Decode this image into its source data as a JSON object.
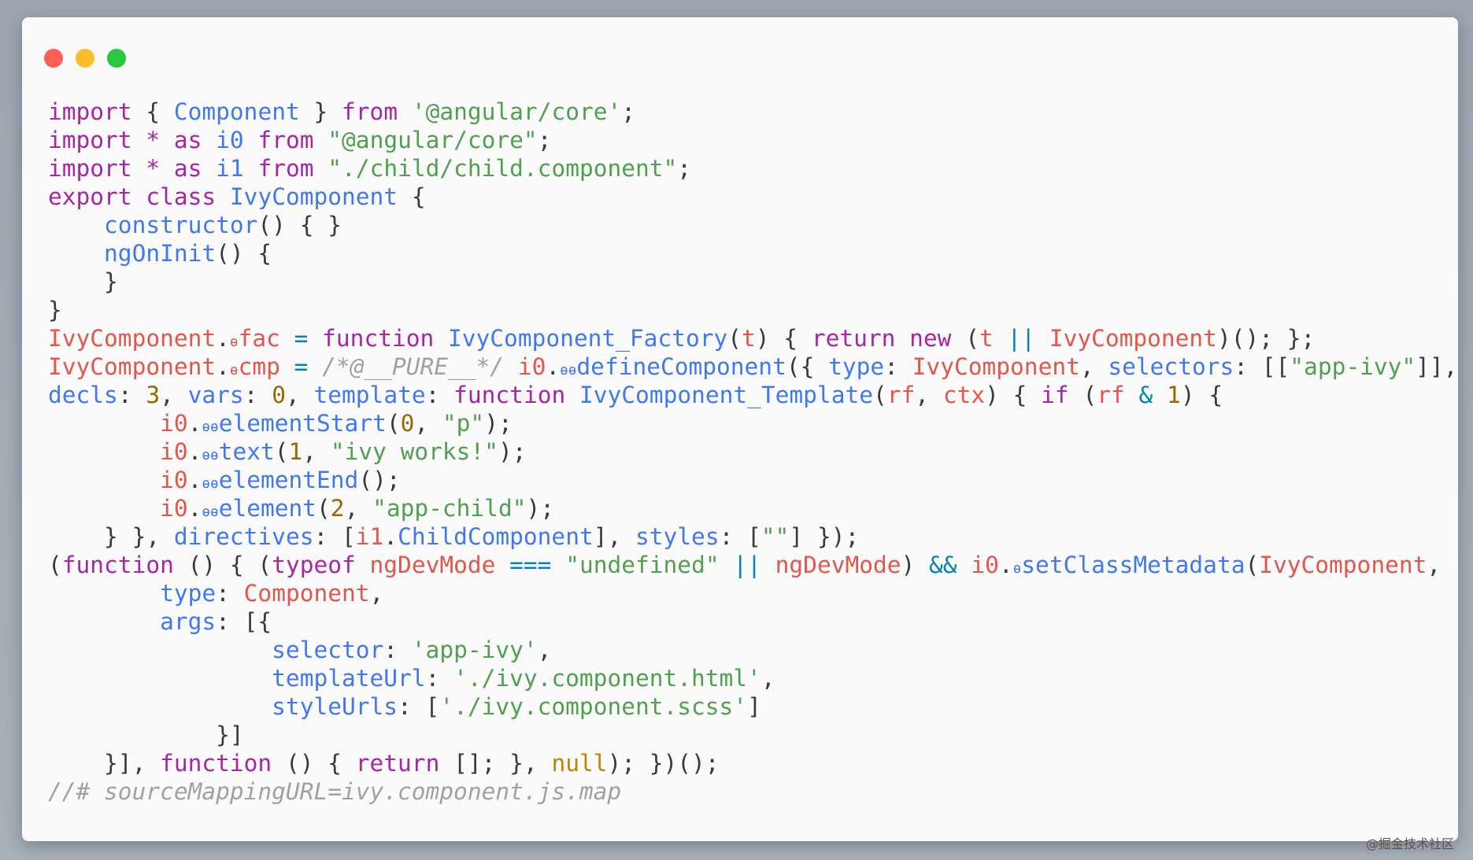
{
  "colors": {
    "keyword": "#a626a4",
    "name": "#4078f2",
    "string": "#50a14f",
    "variable": "#e45649",
    "number": "#986801",
    "constant": "#c18401",
    "operator": "#0184bc",
    "comment": "#a0a1a7",
    "plain": "#383a42"
  },
  "window": {
    "buttons": [
      "close",
      "minimize",
      "maximize"
    ]
  },
  "code_lines": [
    [
      [
        "k",
        "import"
      ],
      [
        "p",
        " { "
      ],
      [
        "n",
        "Component"
      ],
      [
        "p",
        " } "
      ],
      [
        "k",
        "from"
      ],
      [
        "p",
        " "
      ],
      [
        "s",
        "'@angular/core'"
      ],
      [
        "p",
        ";"
      ]
    ],
    [
      [
        "k",
        "import"
      ],
      [
        "p",
        " "
      ],
      [
        "k",
        "*"
      ],
      [
        "p",
        " "
      ],
      [
        "k",
        "as"
      ],
      [
        "p",
        " "
      ],
      [
        "n",
        "i0"
      ],
      [
        "p",
        " "
      ],
      [
        "k",
        "from"
      ],
      [
        "p",
        " "
      ],
      [
        "s",
        "\"@angular/core\""
      ],
      [
        "p",
        ";"
      ]
    ],
    [
      [
        "k",
        "import"
      ],
      [
        "p",
        " "
      ],
      [
        "k",
        "*"
      ],
      [
        "p",
        " "
      ],
      [
        "k",
        "as"
      ],
      [
        "p",
        " "
      ],
      [
        "n",
        "i1"
      ],
      [
        "p",
        " "
      ],
      [
        "k",
        "from"
      ],
      [
        "p",
        " "
      ],
      [
        "s",
        "\"./child/child.component\""
      ],
      [
        "p",
        ";"
      ]
    ],
    [
      [
        "k",
        "export"
      ],
      [
        "p",
        " "
      ],
      [
        "k",
        "class"
      ],
      [
        "p",
        " "
      ],
      [
        "n",
        "IvyComponent"
      ],
      [
        "p",
        " {"
      ]
    ],
    [
      [
        "p",
        "    "
      ],
      [
        "n",
        "constructor"
      ],
      [
        "p",
        "() { }"
      ]
    ],
    [
      [
        "p",
        "    "
      ],
      [
        "n",
        "ngOnInit"
      ],
      [
        "p",
        "() {"
      ]
    ],
    [
      [
        "p",
        "    }"
      ]
    ],
    [
      [
        "p",
        "}"
      ]
    ],
    [
      [
        "v",
        "IvyComponent"
      ],
      [
        "p",
        "."
      ],
      [
        "vsub",
        "ɵ"
      ],
      [
        "v",
        "fac"
      ],
      [
        "p",
        " "
      ],
      [
        "o",
        "="
      ],
      [
        "p",
        " "
      ],
      [
        "k",
        "function"
      ],
      [
        "p",
        " "
      ],
      [
        "n",
        "IvyComponent_Factory"
      ],
      [
        "p",
        "("
      ],
      [
        "v",
        "t"
      ],
      [
        "p",
        ") { "
      ],
      [
        "k",
        "return"
      ],
      [
        "p",
        " "
      ],
      [
        "k",
        "new"
      ],
      [
        "p",
        " ("
      ],
      [
        "v",
        "t"
      ],
      [
        "p",
        " "
      ],
      [
        "o",
        "||"
      ],
      [
        "p",
        " "
      ],
      [
        "v",
        "IvyComponent"
      ],
      [
        "p",
        ")(); };"
      ]
    ],
    [
      [
        "v",
        "IvyComponent"
      ],
      [
        "p",
        "."
      ],
      [
        "vsub",
        "ɵ"
      ],
      [
        "v",
        "cmp"
      ],
      [
        "p",
        " "
      ],
      [
        "o",
        "="
      ],
      [
        "p",
        " "
      ],
      [
        "c",
        "/*@__PURE__*/"
      ],
      [
        "p",
        " "
      ],
      [
        "v",
        "i0"
      ],
      [
        "p",
        "."
      ],
      [
        "nsub",
        "ɵɵ"
      ],
      [
        "n",
        "defineComponent"
      ],
      [
        "p",
        "({ "
      ],
      [
        "n",
        "type"
      ],
      [
        "p",
        ": "
      ],
      [
        "v",
        "IvyComponent"
      ],
      [
        "p",
        ", "
      ],
      [
        "n",
        "selectors"
      ],
      [
        "p",
        ": [["
      ],
      [
        "s",
        "\"app-ivy\""
      ],
      [
        "p",
        "]],"
      ]
    ],
    [
      [
        "n",
        "decls"
      ],
      [
        "p",
        ": "
      ],
      [
        "m",
        "3"
      ],
      [
        "p",
        ", "
      ],
      [
        "n",
        "vars"
      ],
      [
        "p",
        ": "
      ],
      [
        "m",
        "0"
      ],
      [
        "p",
        ", "
      ],
      [
        "n",
        "template"
      ],
      [
        "p",
        ": "
      ],
      [
        "k",
        "function"
      ],
      [
        "p",
        " "
      ],
      [
        "n",
        "IvyComponent_Template"
      ],
      [
        "p",
        "("
      ],
      [
        "v",
        "rf"
      ],
      [
        "p",
        ", "
      ],
      [
        "v",
        "ctx"
      ],
      [
        "p",
        ") { "
      ],
      [
        "k",
        "if"
      ],
      [
        "p",
        " ("
      ],
      [
        "v",
        "rf"
      ],
      [
        "p",
        " "
      ],
      [
        "o",
        "&"
      ],
      [
        "p",
        " "
      ],
      [
        "m",
        "1"
      ],
      [
        "p",
        ") {"
      ]
    ],
    [
      [
        "p",
        "        "
      ],
      [
        "v",
        "i0"
      ],
      [
        "p",
        "."
      ],
      [
        "nsub",
        "ɵɵ"
      ],
      [
        "n",
        "elementStart"
      ],
      [
        "p",
        "("
      ],
      [
        "m",
        "0"
      ],
      [
        "p",
        ", "
      ],
      [
        "s",
        "\"p\""
      ],
      [
        "p",
        ");"
      ]
    ],
    [
      [
        "p",
        "        "
      ],
      [
        "v",
        "i0"
      ],
      [
        "p",
        "."
      ],
      [
        "nsub",
        "ɵɵ"
      ],
      [
        "n",
        "text"
      ],
      [
        "p",
        "("
      ],
      [
        "m",
        "1"
      ],
      [
        "p",
        ", "
      ],
      [
        "s",
        "\"ivy works!\""
      ],
      [
        "p",
        ");"
      ]
    ],
    [
      [
        "p",
        "        "
      ],
      [
        "v",
        "i0"
      ],
      [
        "p",
        "."
      ],
      [
        "nsub",
        "ɵɵ"
      ],
      [
        "n",
        "elementEnd"
      ],
      [
        "p",
        "();"
      ]
    ],
    [
      [
        "p",
        "        "
      ],
      [
        "v",
        "i0"
      ],
      [
        "p",
        "."
      ],
      [
        "nsub",
        "ɵɵ"
      ],
      [
        "n",
        "element"
      ],
      [
        "p",
        "("
      ],
      [
        "m",
        "2"
      ],
      [
        "p",
        ", "
      ],
      [
        "s",
        "\"app-child\""
      ],
      [
        "p",
        ");"
      ]
    ],
    [
      [
        "p",
        "    } }, "
      ],
      [
        "n",
        "directives"
      ],
      [
        "p",
        ": ["
      ],
      [
        "v",
        "i1"
      ],
      [
        "p",
        "."
      ],
      [
        "n",
        "ChildComponent"
      ],
      [
        "p",
        "], "
      ],
      [
        "n",
        "styles"
      ],
      [
        "p",
        ": ["
      ],
      [
        "s",
        "\"\""
      ],
      [
        "p",
        "] });"
      ]
    ],
    [
      [
        "p",
        "("
      ],
      [
        "k",
        "function"
      ],
      [
        "p",
        " () { ("
      ],
      [
        "k",
        "typeof"
      ],
      [
        "p",
        " "
      ],
      [
        "v",
        "ngDevMode"
      ],
      [
        "p",
        " "
      ],
      [
        "o",
        "==="
      ],
      [
        "p",
        " "
      ],
      [
        "s",
        "\"undefined\""
      ],
      [
        "p",
        " "
      ],
      [
        "o",
        "||"
      ],
      [
        "p",
        " "
      ],
      [
        "v",
        "ngDevMode"
      ],
      [
        "p",
        ") "
      ],
      [
        "o",
        "&&"
      ],
      [
        "p",
        " "
      ],
      [
        "v",
        "i0"
      ],
      [
        "p",
        "."
      ],
      [
        "nsub",
        "ɵ"
      ],
      [
        "n",
        "setClassMetadata"
      ],
      [
        "p",
        "("
      ],
      [
        "v",
        "IvyComponent"
      ],
      [
        "p",
        ", [{"
      ]
    ],
    [
      [
        "p",
        "        "
      ],
      [
        "n",
        "type"
      ],
      [
        "p",
        ": "
      ],
      [
        "v",
        "Component"
      ],
      [
        "p",
        ","
      ]
    ],
    [
      [
        "p",
        "        "
      ],
      [
        "n",
        "args"
      ],
      [
        "p",
        ": [{"
      ]
    ],
    [
      [
        "p",
        "                "
      ],
      [
        "n",
        "selector"
      ],
      [
        "p",
        ": "
      ],
      [
        "s",
        "'app-ivy'"
      ],
      [
        "p",
        ","
      ]
    ],
    [
      [
        "p",
        "                "
      ],
      [
        "n",
        "templateUrl"
      ],
      [
        "p",
        ": "
      ],
      [
        "s",
        "'./ivy.component.html'"
      ],
      [
        "p",
        ","
      ]
    ],
    [
      [
        "p",
        "                "
      ],
      [
        "n",
        "styleUrls"
      ],
      [
        "p",
        ": ["
      ],
      [
        "s",
        "'./ivy.component.scss'"
      ],
      [
        "p",
        "]"
      ]
    ],
    [
      [
        "p",
        "            }]"
      ]
    ],
    [
      [
        "p",
        "    }], "
      ],
      [
        "k",
        "function"
      ],
      [
        "p",
        " () { "
      ],
      [
        "k",
        "return"
      ],
      [
        "p",
        " []; }, "
      ],
      [
        "z",
        "null"
      ],
      [
        "p",
        "); })();"
      ]
    ],
    [
      [
        "c",
        "//# sourceMappingURL=ivy.component.js.map"
      ]
    ]
  ],
  "watermark": "@掘金技术社区"
}
